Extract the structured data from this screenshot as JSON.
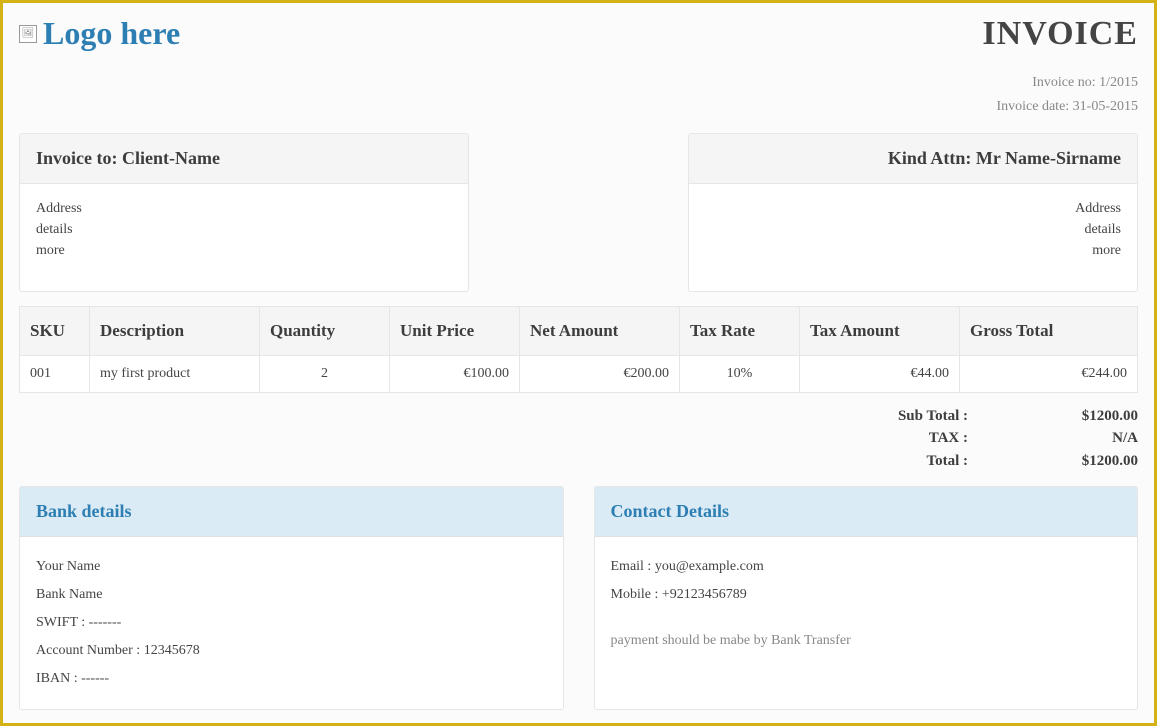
{
  "header": {
    "logo_text": "Logo here",
    "invoice_title": "INVOICE"
  },
  "meta": {
    "invoice_no": "Invoice no: 1/2015",
    "invoice_date": "Invoice date: 31-05-2015"
  },
  "invoice_to": {
    "title": "Invoice to: Client-Name",
    "line1": "Address",
    "line2": "details",
    "line3": "more"
  },
  "kind_attn": {
    "title": "Kind Attn: Mr Name-Sirname",
    "line1": "Address",
    "line2": "details",
    "line3": "more"
  },
  "table": {
    "headers": {
      "sku": "SKU",
      "description": "Description",
      "quantity": "Quantity",
      "unit_price": "Unit Price",
      "net_amount": "Net Amount",
      "tax_rate": "Tax Rate",
      "tax_amount": "Tax Amount",
      "gross_total": "Gross Total"
    },
    "rows": [
      {
        "sku": "001",
        "description": "my first product",
        "quantity": "2",
        "unit_price": "€100.00",
        "net_amount": "€200.00",
        "tax_rate": "10%",
        "tax_amount": "€44.00",
        "gross_total": "€244.00"
      }
    ]
  },
  "totals": {
    "sub_total_label": "Sub Total :",
    "sub_total_value": "$1200.00",
    "tax_label": "TAX :",
    "tax_value": "N/A",
    "total_label": "Total :",
    "total_value": "$1200.00"
  },
  "bank_details": {
    "title": "Bank details",
    "name": "Your Name",
    "bank": "Bank Name",
    "swift": "SWIFT : -------",
    "account": "Account Number : 12345678",
    "iban": "IBAN : ------"
  },
  "contact_details": {
    "title": "Contact Details",
    "email": "Email : you@example.com",
    "mobile": "Mobile : +92123456789",
    "note": "payment should be mabe by Bank Transfer"
  }
}
